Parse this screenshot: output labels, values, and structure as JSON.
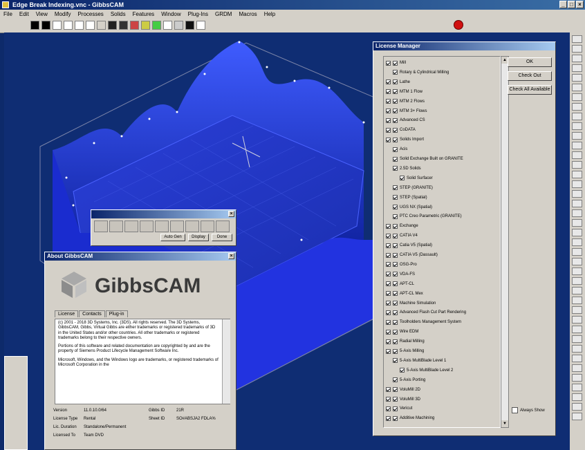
{
  "window": {
    "title": "Edge Break Indexing.vnc - GibbsCAM"
  },
  "menu": [
    "File",
    "Edit",
    "View",
    "Modify",
    "Processes",
    "Solids",
    "Features",
    "Window",
    "Plug-Ins",
    "GRDM",
    "Macros",
    "Help"
  ],
  "toolbar": {
    "stop_icon": "stop-icon"
  },
  "layout_manager": {
    "title": "License Manager",
    "buttons": {
      "ok": "OK",
      "check_out": "Check Out",
      "check_all": "Check All Available"
    },
    "always_show": "Always Show",
    "items": [
      {
        "label": "Mill",
        "indent": 0
      },
      {
        "label": "Rotary & Cylindrical Milling",
        "indent": 1
      },
      {
        "label": "Lathe",
        "indent": 0
      },
      {
        "label": "MTM 1 Flow",
        "indent": 0
      },
      {
        "label": "MTM 2 Flows",
        "indent": 0
      },
      {
        "label": "MTM 3+ Flows",
        "indent": 0
      },
      {
        "label": "Advanced CS",
        "indent": 0
      },
      {
        "label": "CoDATA",
        "indent": 0
      },
      {
        "label": "Solids Import",
        "indent": 0
      },
      {
        "label": "Acis",
        "indent": 1
      },
      {
        "label": "Solid Exchange Built on GRANITE",
        "indent": 1
      },
      {
        "label": "2.5D Solids",
        "indent": 1
      },
      {
        "label": "Solid Surfacer",
        "indent": 2
      },
      {
        "label": "STEP (GRANITE)",
        "indent": 1
      },
      {
        "label": "STEP (Spatial)",
        "indent": 1
      },
      {
        "label": "UGS NX (Spatial)",
        "indent": 1
      },
      {
        "label": "PTC Creo Parametric (GRANITE)",
        "indent": 1
      },
      {
        "label": "Exchange",
        "indent": 0
      },
      {
        "label": "CATIA V4",
        "indent": 0
      },
      {
        "label": "Catia V5 (Spatial)",
        "indent": 0
      },
      {
        "label": "CATIA V5 (Dassault)",
        "indent": 0
      },
      {
        "label": "OSG-Pro",
        "indent": 0
      },
      {
        "label": "VDA-FS",
        "indent": 0
      },
      {
        "label": "APT-CL",
        "indent": 0
      },
      {
        "label": "APT-CL Mex",
        "indent": 0
      },
      {
        "label": "Machine Simulation",
        "indent": 0
      },
      {
        "label": "Advanced Flash Cut Part Rendering",
        "indent": 0
      },
      {
        "label": "Toolholders Management System",
        "indent": 0
      },
      {
        "label": "Wire EDM",
        "indent": 0
      },
      {
        "label": "Radial Milling",
        "indent": 0
      },
      {
        "label": "5-Axis Milling",
        "indent": 0
      },
      {
        "label": "5-Axis MultiBlade Level 1",
        "indent": 1
      },
      {
        "label": "5-Axis MultiBlade Level 2",
        "indent": 2
      },
      {
        "label": "5-Axis Porting",
        "indent": 1
      },
      {
        "label": "VoluMill 2D",
        "indent": 0
      },
      {
        "label": "VoluMill 3D",
        "indent": 0
      },
      {
        "label": "Vericut",
        "indent": 0
      },
      {
        "label": "Additive Machining",
        "indent": 0
      }
    ]
  },
  "about": {
    "title": "About GibbsCAM",
    "brand": "GibbsCAM",
    "tabs": [
      "License",
      "Contacts",
      "Plug-in"
    ],
    "license_paragraphs": [
      "(c) 2001 - 2018 3D Systems, Inc. (3DS). All rights reserved. The 3D Systems, GibbsCAM, Gibbs, Virtual Gibbs are either trademarks or registered trademarks of 3D in the United States and/or other countries. All other trademarks or registered trademarks belong to their respective owners.",
      "Portions of this software and related documentation are copyrighted by and are the property of Siemens Product Lifecycle Management Software Inc.",
      "Microsoft, Windows, and the Windows logo are trademarks, or registered trademarks of Microsoft Corporation in the"
    ],
    "info": {
      "version_label": "Version",
      "version_value": "11.0.10.0/64",
      "license_type_label": "License Type",
      "license_type_value": "Rental",
      "duration_label": "Lic. Duration",
      "duration_value": "Standalone/Permanent",
      "licensed_to_label": "Licensed To",
      "licensed_to_value": "Team DVD",
      "gibbs_id_label": "Gibbs ID",
      "gibbs_id_value": "21R",
      "sheet_id_label": "Sheet ID",
      "sheet_id_value": "SO#ABSJA2 FDLA%"
    }
  },
  "mini_toolbar": {
    "label": "Auto Gen",
    "btn2": "Display",
    "btn3": "Done"
  }
}
